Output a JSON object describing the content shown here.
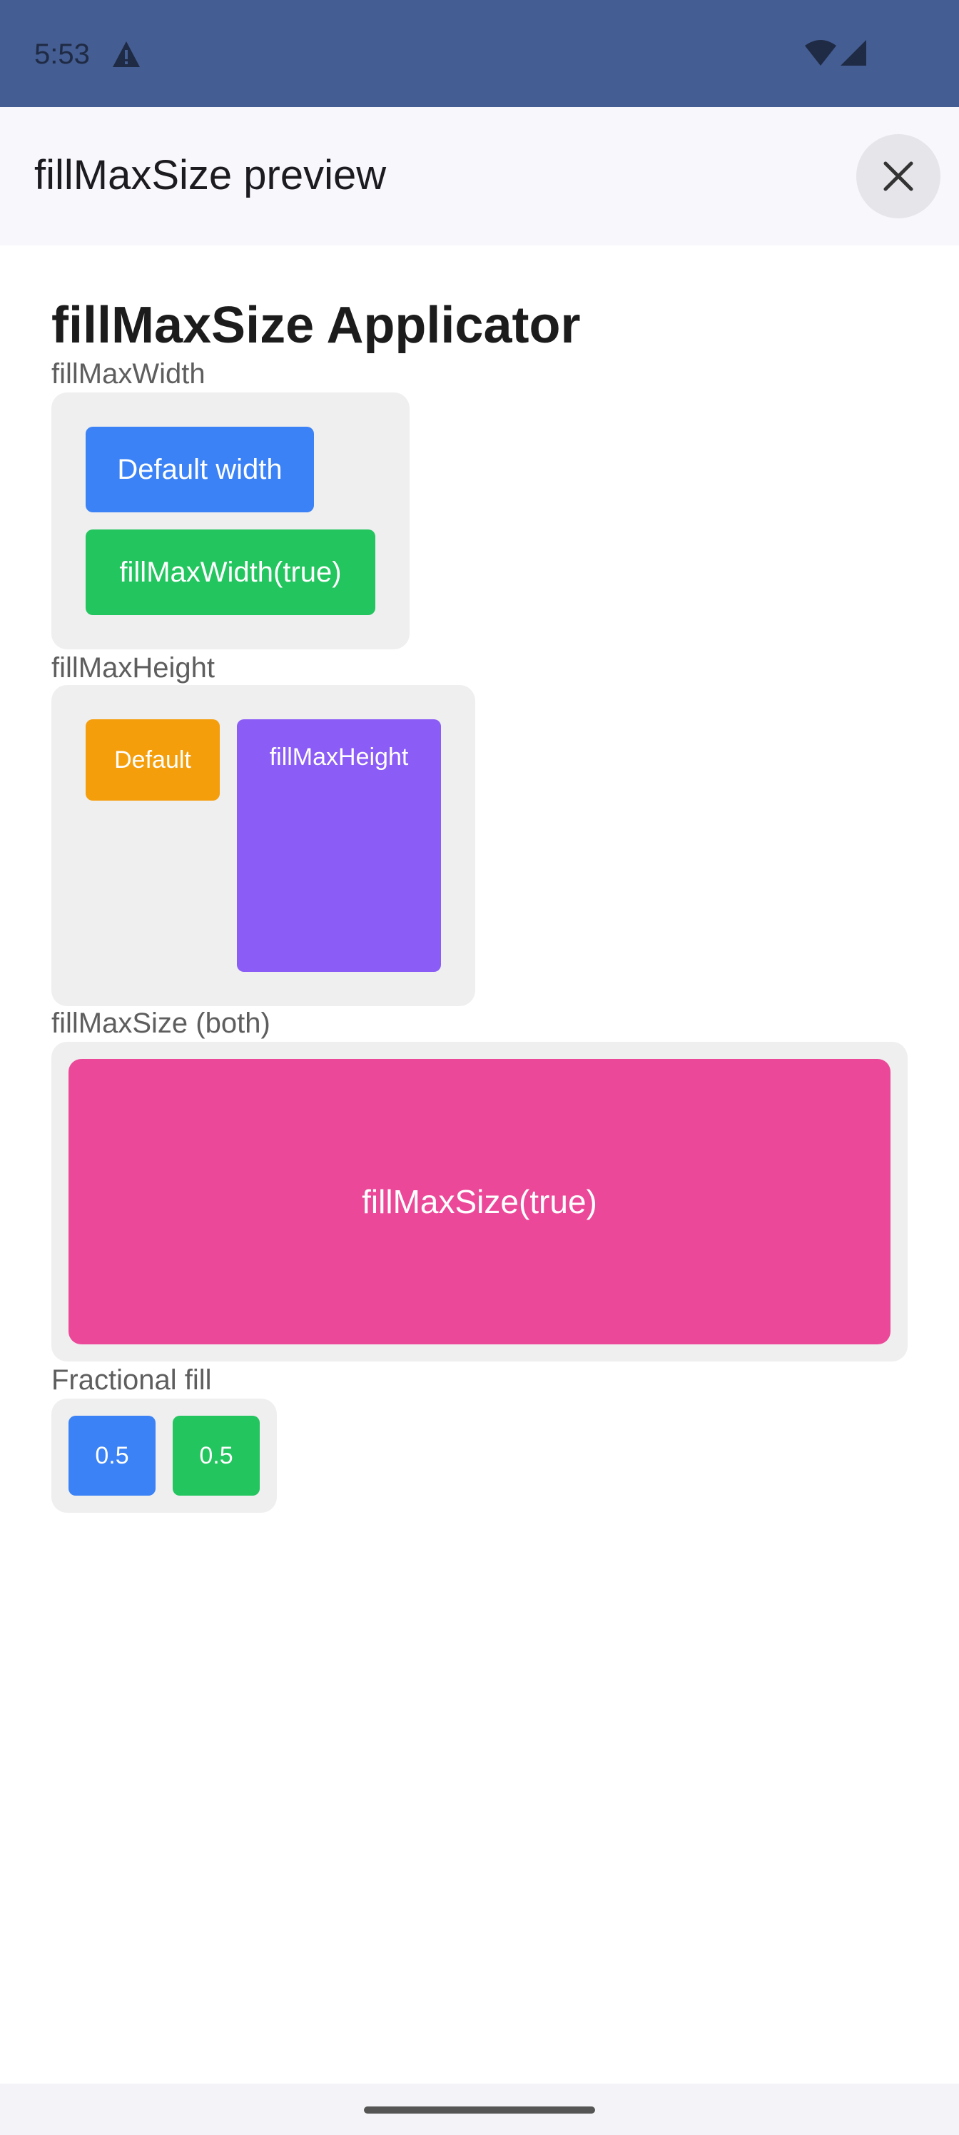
{
  "status_bar": {
    "time": "5:53",
    "icons": [
      "warning-icon",
      "wifi-icon",
      "signal-icon"
    ]
  },
  "app_bar": {
    "title": "fillMaxSize preview",
    "close_icon": "close-icon"
  },
  "content": {
    "title": "fillMaxSize Applicator",
    "sections": {
      "fill_max_width": {
        "label": "fillMaxWidth",
        "default_chip": "Default width",
        "fill_chip": "fillMaxWidth(true)"
      },
      "fill_max_height": {
        "label": "fillMaxHeight",
        "default_chip": "Default",
        "fill_chip": "fillMaxHeight"
      },
      "fill_max_size": {
        "label": "fillMaxSize (both)",
        "fill_chip": "fillMaxSize(true)"
      },
      "fractional": {
        "label": "Fractional fill",
        "chips": [
          "0.5",
          "0.5"
        ]
      }
    }
  },
  "colors": {
    "status_bar": "#445d92",
    "blue": "#3b82f6",
    "green": "#22c55e",
    "orange": "#f59e0b",
    "purple": "#8b5cf6",
    "pink": "#ec4899",
    "panel": "#efefef"
  }
}
